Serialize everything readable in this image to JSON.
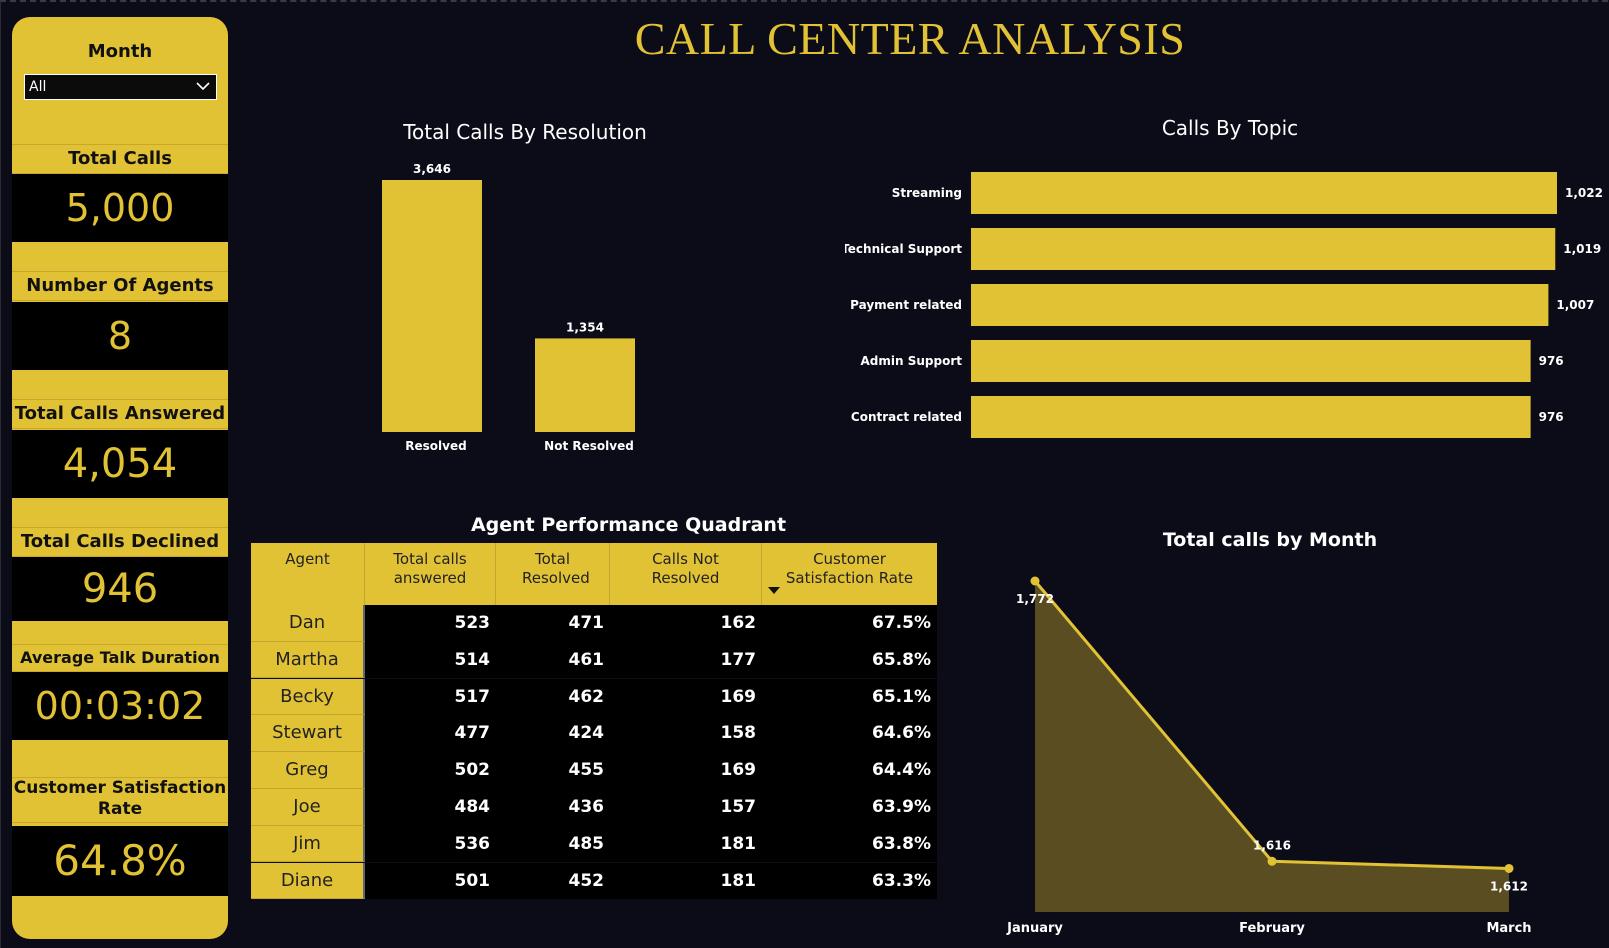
{
  "title": "CALL CENTER ANALYSIS",
  "sidebar": {
    "month_label": "Month",
    "month_value": "All",
    "kpis": [
      {
        "label": "Total Calls",
        "value": "5,000"
      },
      {
        "label": "Number Of Agents",
        "value": "8"
      },
      {
        "label": "Total Calls Answered",
        "value": "4,054"
      },
      {
        "label": "Total Calls Declined",
        "value": "946"
      },
      {
        "label": "Average Talk Duration",
        "value": "00:03:02"
      },
      {
        "label": "Customer Satisfaction Rate",
        "value": "64.8%"
      }
    ]
  },
  "colors": {
    "accent": "#e2c235",
    "background": "#0b0c17",
    "area_fill": "#5a4d22"
  },
  "chart_data": [
    {
      "type": "bar",
      "title": "Total Calls By Resolution",
      "categories": [
        "Resolved",
        "Not Resolved"
      ],
      "values": [
        3646,
        1354
      ],
      "labels": [
        "3,646",
        "1,354"
      ],
      "ylim": [
        0,
        3646
      ]
    },
    {
      "type": "bar",
      "orientation": "horizontal",
      "title": "Calls By Topic",
      "categories": [
        "Streaming",
        "Technical Support",
        "Payment related",
        "Admin Support",
        "Contract related"
      ],
      "values": [
        1022,
        1019,
        1007,
        976,
        976
      ],
      "labels": [
        "1,022",
        "1,019",
        "1,007",
        "976",
        "976"
      ],
      "xlim": [
        0,
        1022
      ]
    },
    {
      "type": "area",
      "title": "Total calls by Month",
      "x": [
        "January",
        "February",
        "March"
      ],
      "values": [
        1772,
        1616,
        1612
      ],
      "labels": [
        "1,772",
        "1,616",
        "1,612"
      ],
      "ylim": [
        1600,
        1772
      ]
    }
  ],
  "table": {
    "title": "Agent Performance Quadrant",
    "columns": [
      "Agent",
      "Total calls answered",
      "Total Resolved",
      "Calls Not Resolved",
      "Customer Satisfaction Rate"
    ],
    "rows": [
      [
        "Dan",
        "523",
        "471",
        "162",
        "67.5%"
      ],
      [
        "Martha",
        "514",
        "461",
        "177",
        "65.8%"
      ],
      [
        "Becky",
        "517",
        "462",
        "169",
        "65.1%"
      ],
      [
        "Stewart",
        "477",
        "424",
        "158",
        "64.6%"
      ],
      [
        "Greg",
        "502",
        "455",
        "169",
        "64.4%"
      ],
      [
        "Joe",
        "484",
        "436",
        "157",
        "63.9%"
      ],
      [
        "Jim",
        "536",
        "485",
        "181",
        "63.8%"
      ],
      [
        "Diane",
        "501",
        "452",
        "181",
        "63.3%"
      ]
    ]
  }
}
